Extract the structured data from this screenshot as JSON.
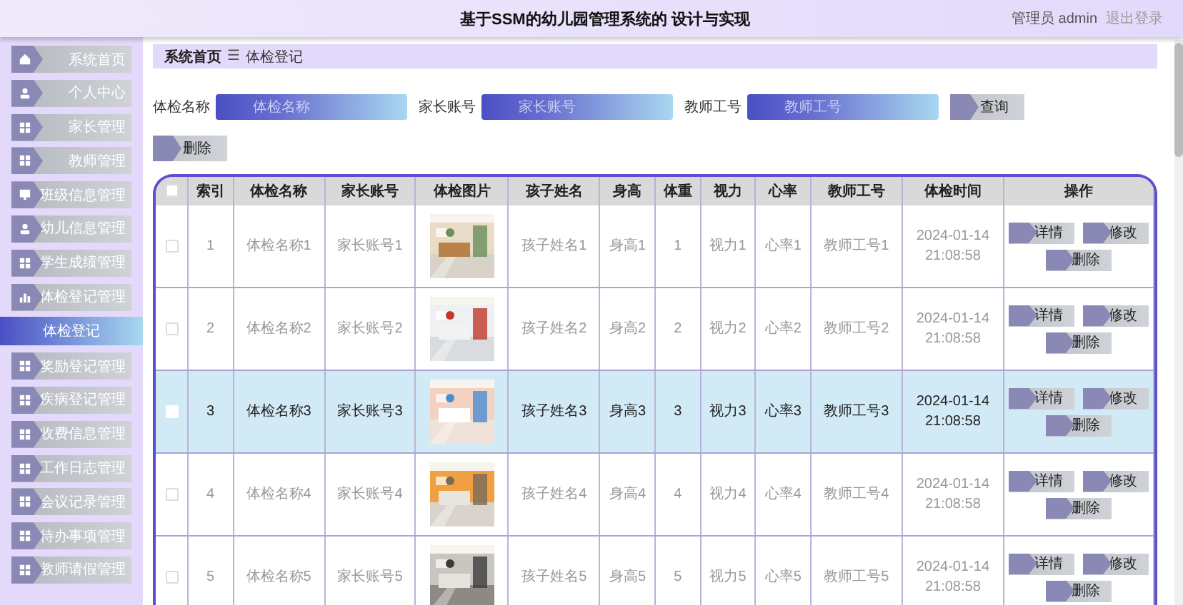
{
  "header": {
    "title": "基于SSM的幼儿园管理系统的 设计与实现",
    "user": "管理员 admin",
    "logout": "退出登录"
  },
  "sidebar": {
    "items": [
      {
        "label": "系统首页",
        "selected": false
      },
      {
        "label": "个人中心",
        "selected": false
      },
      {
        "label": "家长管理",
        "selected": false
      },
      {
        "label": "教师管理",
        "selected": false
      },
      {
        "label": "班级信息管理",
        "selected": false
      },
      {
        "label": "幼儿信息管理",
        "selected": false
      },
      {
        "label": "学生成绩管理",
        "selected": false
      },
      {
        "label": "体检登记管理",
        "selected": false,
        "children": [
          {
            "label": "体检登记",
            "selected": true
          }
        ]
      },
      {
        "label": "奖励登记管理",
        "selected": false
      },
      {
        "label": "疾病登记管理",
        "selected": false
      },
      {
        "label": "收费信息管理",
        "selected": false
      },
      {
        "label": "工作日志管理",
        "selected": false
      },
      {
        "label": "会议记录管理",
        "selected": false
      },
      {
        "label": "待办事项管理",
        "selected": false
      },
      {
        "label": "教师请假管理",
        "selected": false
      }
    ]
  },
  "breadcrumb": {
    "home": "系统首页",
    "separator": "☰",
    "current": "体检登记"
  },
  "search": {
    "fields": [
      {
        "label": "体检名称",
        "placeholder": "体检名称"
      },
      {
        "label": "家长账号",
        "placeholder": "家长账号"
      },
      {
        "label": "教师工号",
        "placeholder": "教师工号"
      }
    ],
    "query_button": "查询",
    "delete_button": "删除"
  },
  "table": {
    "all_selected": false,
    "columns": [
      "索引",
      "体检名称",
      "家长账号",
      "体检图片",
      "孩子姓名",
      "身高",
      "体重",
      "视力",
      "心率",
      "教师工号",
      "体检时间",
      "操作"
    ],
    "rows": [
      {
        "selected": false,
        "cells": [
          "1",
          "体检名称1",
          "家长账号1",
          {
            "kind": "picture"
          },
          "孩子姓名1",
          "身高1",
          "1",
          "视力1",
          "心率1",
          "教师工号1",
          "2024-01-14\n21:08:58"
        ],
        "actions": [
          "详情",
          "修改",
          "删除"
        ]
      },
      {
        "selected": false,
        "cells": [
          "2",
          "体检名称2",
          "家长账号2",
          {
            "kind": "picture"
          },
          "孩子姓名2",
          "身高2",
          "2",
          "视力2",
          "心率2",
          "教师工号2",
          "2024-01-14\n21:08:58"
        ],
        "actions": [
          "详情",
          "修改",
          "删除"
        ]
      },
      {
        "selected": true,
        "cells": [
          "3",
          "体检名称3",
          "家长账号3",
          {
            "kind": "picture"
          },
          "孩子姓名3",
          "身高3",
          "3",
          "视力3",
          "心率3",
          "教师工号3",
          "2024-01-14\n21:08:58"
        ],
        "actions": [
          "详情",
          "修改",
          "删除"
        ]
      },
      {
        "selected": false,
        "cells": [
          "4",
          "体检名称4",
          "家长账号4",
          {
            "kind": "picture"
          },
          "孩子姓名4",
          "身高4",
          "4",
          "视力4",
          "心率4",
          "教师工号4",
          "2024-01-14\n21:08:58"
        ],
        "actions": [
          "详情",
          "修改",
          "删除"
        ]
      },
      {
        "selected": false,
        "cells": [
          "5",
          "体检名称5",
          "家长账号5",
          {
            "kind": "picture"
          },
          "孩子姓名5",
          "身高5",
          "5",
          "视力5",
          "心率5",
          "教师工号5",
          "2024-01-14\n21:08:58"
        ],
        "actions": [
          "详情",
          "修改",
          "删除"
        ]
      }
    ]
  }
}
